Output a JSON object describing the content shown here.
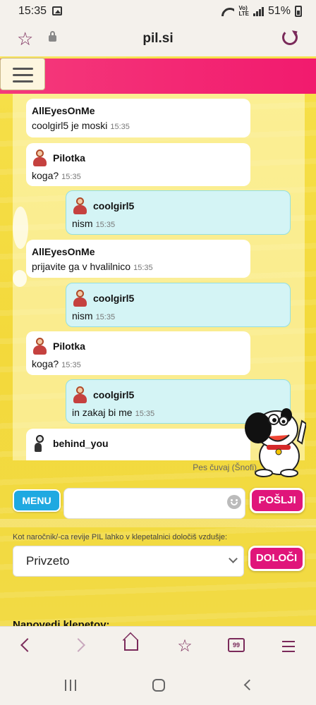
{
  "status_bar": {
    "time": "15:35",
    "battery": "51%",
    "network": "VoLTE LTE"
  },
  "browser": {
    "url": "pil.si"
  },
  "chat": {
    "messages": [
      {
        "user": "AllEyesOnMe",
        "text": "coolgirl5 je moski",
        "time": "15:35",
        "side": "in",
        "avatar": ""
      },
      {
        "user": "Pilotka",
        "text": "koga?",
        "time": "15:35",
        "side": "in",
        "avatar": "girl-avatar-icon"
      },
      {
        "user": "coolgirl5",
        "text": "nism",
        "time": "15:35",
        "side": "out",
        "avatar": "girl-avatar-icon"
      },
      {
        "user": "AllEyesOnMe",
        "text": "prijavite ga v hvalilnico",
        "time": "15:35",
        "side": "in",
        "avatar": ""
      },
      {
        "user": "coolgirl5",
        "text": "nism",
        "time": "15:35",
        "side": "out",
        "avatar": "girl-avatar-icon"
      },
      {
        "user": "Pilotka",
        "text": "koga?",
        "time": "15:35",
        "side": "in",
        "avatar": "girl-avatar-icon"
      },
      {
        "user": "coolgirl5",
        "text": "in zakaj bi me",
        "time": "15:35",
        "side": "out",
        "avatar": "girl-avatar-icon"
      },
      {
        "user": "behind_you",
        "text": "",
        "time": "",
        "side": "in",
        "avatar": "dark-avatar-icon"
      }
    ],
    "mascot_caption": "Pes čuvaj (Šnofi)"
  },
  "composer": {
    "menu_label": "MENU",
    "send_label": "POŠLJI",
    "input_value": ""
  },
  "mood": {
    "note": "Kot naročnik/-ca revije PIL lahko v klepetalnici določiš vzdušje:",
    "selected": "Privzeto",
    "button_label": "DOLOČI"
  },
  "section_title": "Napovedi klepetov:",
  "colors": {
    "accent": "#e0157a",
    "menu_blue": "#1fa9e1",
    "header_pink": "#f43a7b",
    "out_bubble": "#d4f4f5"
  }
}
